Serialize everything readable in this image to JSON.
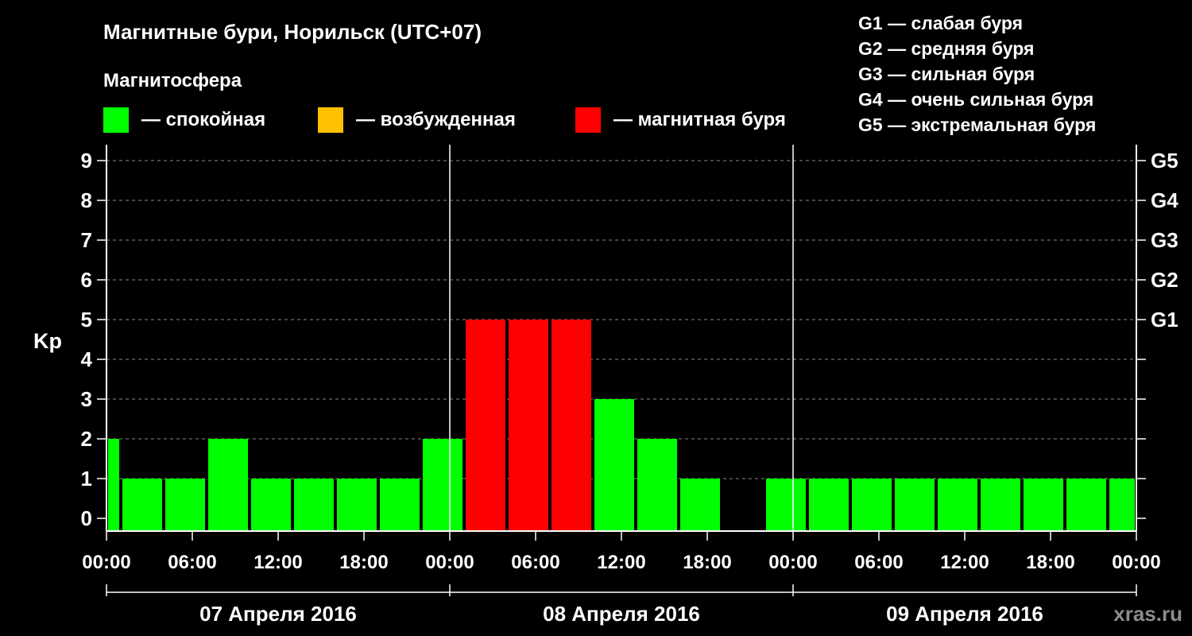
{
  "title": "Магнитные бури, Норильск (UTC+07)",
  "magnetosphere": {
    "heading": "Магнитосфера",
    "legend": [
      {
        "label": "— спокойная",
        "color": "#00ff00"
      },
      {
        "label": "— возбужденная",
        "color": "#ffc000"
      },
      {
        "label": "— магнитная буря",
        "color": "#ff0000"
      }
    ]
  },
  "storm_scale": [
    {
      "text": "G1 — слабая буря"
    },
    {
      "text": "G2 — средняя буря"
    },
    {
      "text": "G3 — сильная буря"
    },
    {
      "text": "G4 — очень сильная буря"
    },
    {
      "text": "G5 — экстремальная буря"
    }
  ],
  "watermark": "xras.ru",
  "chart_data": {
    "type": "bar",
    "ylabel": "Kp",
    "ylim": [
      0,
      9
    ],
    "yticks": [
      "0",
      "1",
      "2",
      "3",
      "4",
      "5",
      "6",
      "7",
      "8",
      "9"
    ],
    "right_ticks": [
      {
        "value": 5,
        "label": "G1"
      },
      {
        "value": 6,
        "label": "G2"
      },
      {
        "value": 7,
        "label": "G3"
      },
      {
        "value": 8,
        "label": "G4"
      },
      {
        "value": 9,
        "label": "G5"
      }
    ],
    "xlim_hours": [
      0,
      72
    ],
    "xticks": [
      {
        "hour": 0,
        "label": "00:00"
      },
      {
        "hour": 6,
        "label": "06:00"
      },
      {
        "hour": 12,
        "label": "12:00"
      },
      {
        "hour": 18,
        "label": "18:00"
      },
      {
        "hour": 24,
        "label": "00:00"
      },
      {
        "hour": 30,
        "label": "06:00"
      },
      {
        "hour": 36,
        "label": "12:00"
      },
      {
        "hour": 42,
        "label": "18:00"
      },
      {
        "hour": 48,
        "label": "00:00"
      },
      {
        "hour": 54,
        "label": "06:00"
      },
      {
        "hour": 60,
        "label": "12:00"
      },
      {
        "hour": 66,
        "label": "18:00"
      },
      {
        "hour": 72,
        "label": "00:00"
      }
    ],
    "days": [
      {
        "label": "07 Апреля 2016",
        "start_hour": 0,
        "end_hour": 24
      },
      {
        "label": "08 Апреля 2016",
        "start_hour": 24,
        "end_hour": 48
      },
      {
        "label": "09 Апреля 2016",
        "start_hour": 48,
        "end_hour": 72
      }
    ],
    "grid": true,
    "bars": [
      {
        "start_hour": 0,
        "end_hour": 1,
        "kp": 2,
        "color": "#00ff00"
      },
      {
        "start_hour": 1,
        "end_hour": 4,
        "kp": 1,
        "color": "#00ff00"
      },
      {
        "start_hour": 4,
        "end_hour": 7,
        "kp": 1,
        "color": "#00ff00"
      },
      {
        "start_hour": 7,
        "end_hour": 10,
        "kp": 2,
        "color": "#00ff00"
      },
      {
        "start_hour": 10,
        "end_hour": 13,
        "kp": 1,
        "color": "#00ff00"
      },
      {
        "start_hour": 13,
        "end_hour": 16,
        "kp": 1,
        "color": "#00ff00"
      },
      {
        "start_hour": 16,
        "end_hour": 19,
        "kp": 1,
        "color": "#00ff00"
      },
      {
        "start_hour": 19,
        "end_hour": 22,
        "kp": 1,
        "color": "#00ff00"
      },
      {
        "start_hour": 22,
        "end_hour": 25,
        "kp": 2,
        "color": "#00ff00"
      },
      {
        "start_hour": 25,
        "end_hour": 28,
        "kp": 5,
        "color": "#ff0000"
      },
      {
        "start_hour": 28,
        "end_hour": 31,
        "kp": 5,
        "color": "#ff0000"
      },
      {
        "start_hour": 31,
        "end_hour": 34,
        "kp": 5,
        "color": "#ff0000"
      },
      {
        "start_hour": 34,
        "end_hour": 37,
        "kp": 3,
        "color": "#00ff00"
      },
      {
        "start_hour": 37,
        "end_hour": 40,
        "kp": 2,
        "color": "#00ff00"
      },
      {
        "start_hour": 40,
        "end_hour": 43,
        "kp": 1,
        "color": "#00ff00"
      },
      {
        "start_hour": 46,
        "end_hour": 49,
        "kp": 1,
        "color": "#00ff00"
      },
      {
        "start_hour": 49,
        "end_hour": 52,
        "kp": 1,
        "color": "#00ff00"
      },
      {
        "start_hour": 52,
        "end_hour": 55,
        "kp": 1,
        "color": "#00ff00"
      },
      {
        "start_hour": 55,
        "end_hour": 58,
        "kp": 1,
        "color": "#00ff00"
      },
      {
        "start_hour": 58,
        "end_hour": 61,
        "kp": 1,
        "color": "#00ff00"
      },
      {
        "start_hour": 61,
        "end_hour": 64,
        "kp": 1,
        "color": "#00ff00"
      },
      {
        "start_hour": 64,
        "end_hour": 67,
        "kp": 1,
        "color": "#00ff00"
      },
      {
        "start_hour": 67,
        "end_hour": 70,
        "kp": 1,
        "color": "#00ff00"
      },
      {
        "start_hour": 70,
        "end_hour": 72,
        "kp": 1,
        "color": "#00ff00"
      }
    ]
  }
}
